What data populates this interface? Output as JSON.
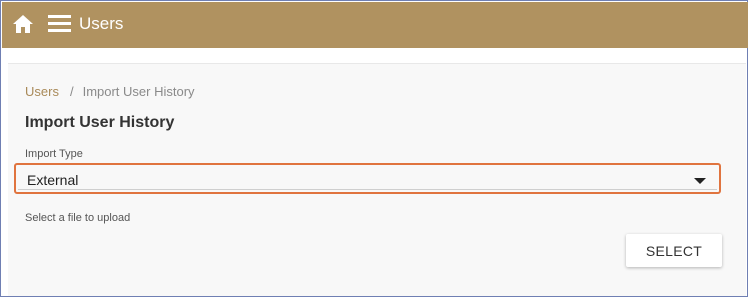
{
  "header": {
    "title": "Users",
    "icons": [
      "home-icon",
      "menu-icon"
    ],
    "background_color": "#b09260"
  },
  "breadcrumb": {
    "items": [
      "Users",
      "Import User History"
    ],
    "separator": "/"
  },
  "page": {
    "title": "Import User History"
  },
  "import_type": {
    "label": "Import Type",
    "value": "External",
    "highlight_color": "#e0743f"
  },
  "upload": {
    "hint": "Select a file to upload",
    "button_label": "SELECT"
  }
}
